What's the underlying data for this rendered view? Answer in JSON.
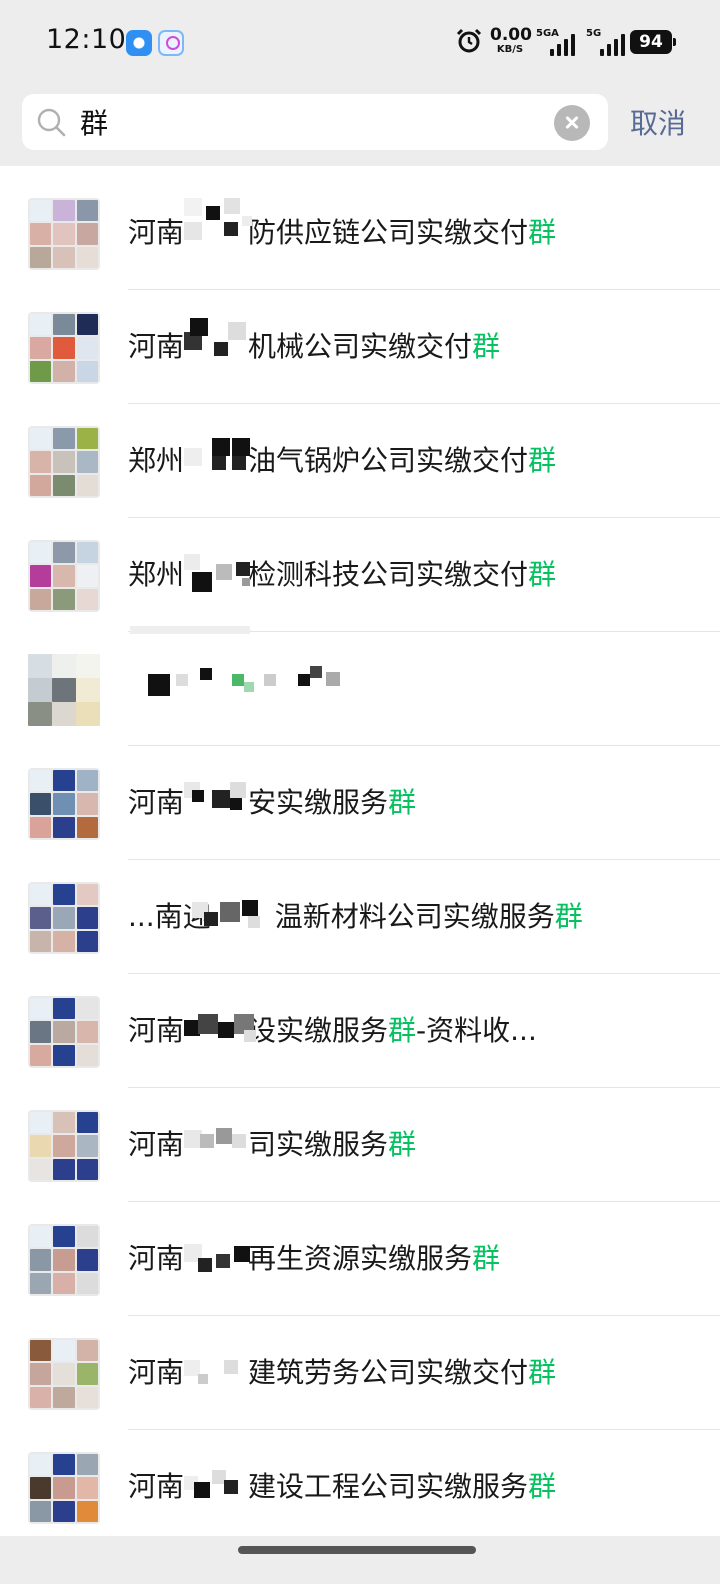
{
  "status_bar": {
    "time": "12:10",
    "net_speed_value": "0.00",
    "net_speed_unit": "KB/S",
    "signal1_label": "5GA",
    "signal2_label": "5G",
    "battery": "94",
    "icons": [
      "browser-app-icon",
      "cloud-app-icon",
      "alarm-icon",
      "signal-icon",
      "battery-icon"
    ]
  },
  "search": {
    "query": "群",
    "placeholder": "",
    "cancel_label": "取消"
  },
  "colors": {
    "highlight": "#07c160",
    "cancel_text": "#576b95",
    "background": "#ededed"
  },
  "results": [
    {
      "prefix": "河南",
      "pre_highlight": "防供应链公司实缴交付",
      "highlight": "群",
      "post_highlight": ""
    },
    {
      "prefix": "河南",
      "pre_highlight": "机械公司实缴交付",
      "highlight": "群",
      "post_highlight": ""
    },
    {
      "prefix": "郑州",
      "pre_highlight": "油气锅炉公司实缴交付",
      "highlight": "群",
      "post_highlight": ""
    },
    {
      "prefix": "郑州",
      "pre_highlight": "检测科技公司实缴交付",
      "highlight": "群",
      "post_highlight": ""
    },
    {
      "prefix": "",
      "pre_highlight": "",
      "highlight": "",
      "post_highlight": ""
    },
    {
      "prefix": "河南",
      "pre_highlight": "安实缴服务",
      "highlight": "群",
      "post_highlight": ""
    },
    {
      "prefix": "...南迎",
      "pre_highlight": "温新材料公司实缴服务",
      "highlight": "群",
      "post_highlight": ""
    },
    {
      "prefix": "河南",
      "pre_highlight": "设实缴服务",
      "highlight": "群",
      "post_highlight": "-资料收..."
    },
    {
      "prefix": "河南",
      "pre_highlight": "司实缴服务",
      "highlight": "群",
      "post_highlight": ""
    },
    {
      "prefix": "河南",
      "pre_highlight": "再生资源实缴服务",
      "highlight": "群",
      "post_highlight": ""
    },
    {
      "prefix": "河南",
      "pre_highlight": "建筑劳务公司实缴交付",
      "highlight": "群",
      "post_highlight": ""
    },
    {
      "prefix": "河南",
      "pre_highlight": "建设工程公司实缴服务",
      "highlight": "群",
      "post_highlight": ""
    }
  ]
}
